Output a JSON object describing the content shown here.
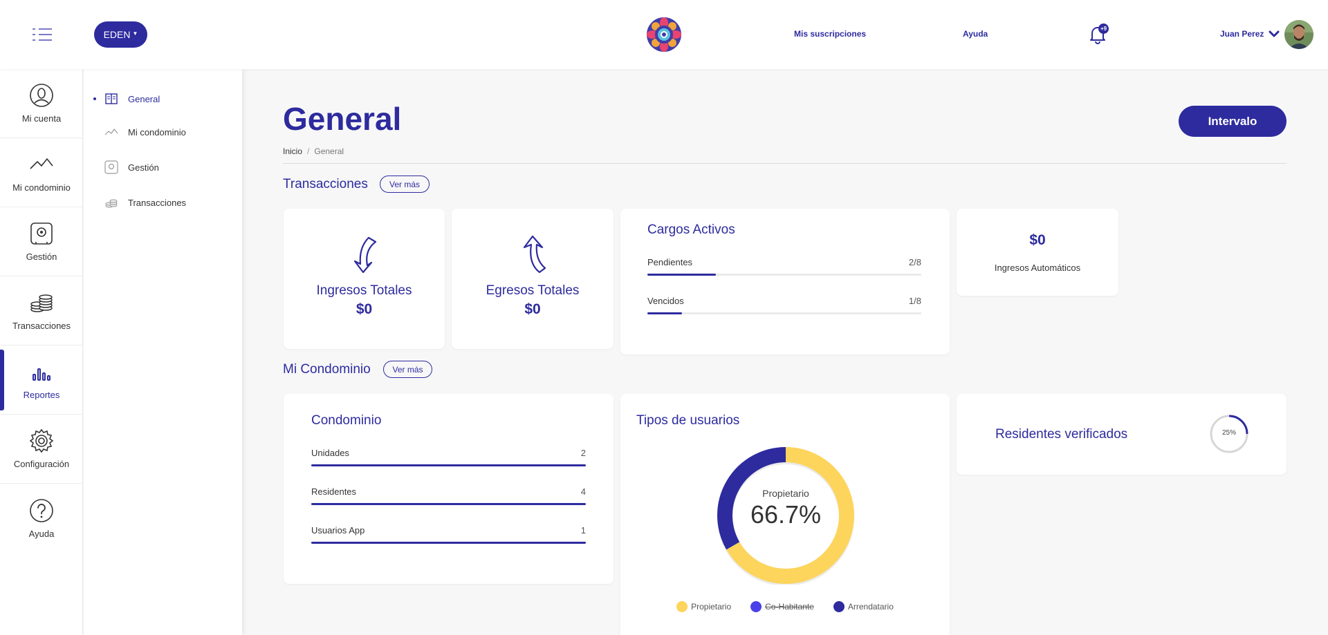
{
  "header": {
    "project_label": "EDEN",
    "links": {
      "subscriptions": "Mis suscripciones",
      "help": "Ayuda"
    },
    "notifications_badge": "+9",
    "user_name": "Juan Perez",
    "accent_color": "#2d2b9e"
  },
  "rail": {
    "items": [
      {
        "label": "Mi cuenta",
        "icon": "user-circle-icon"
      },
      {
        "label": "Mi condominio",
        "icon": "roof-icon"
      },
      {
        "label": "Gestión",
        "icon": "safe-icon"
      },
      {
        "label": "Transacciones",
        "icon": "coins-icon"
      },
      {
        "label": "Reportes",
        "icon": "bar-chart-icon",
        "active": true
      },
      {
        "label": "Configuración",
        "icon": "gear-icon"
      },
      {
        "label": "Ayuda",
        "icon": "question-icon"
      }
    ]
  },
  "subnav": {
    "items": [
      {
        "label": "General",
        "icon": "book-icon",
        "active": true
      },
      {
        "label": "Mi condominio",
        "icon": "roof-icon"
      },
      {
        "label": "Gestión",
        "icon": "safe-icon"
      },
      {
        "label": "Transacciones",
        "icon": "coins-icon"
      }
    ]
  },
  "main": {
    "title": "General",
    "interval_button": "Intervalo",
    "breadcrumb": {
      "home": "Inicio",
      "sep": "/",
      "current": "General"
    },
    "transactions": {
      "section_title": "Transacciones",
      "ver_mas": "Ver más",
      "income": {
        "label": "Ingresos Totales",
        "value": "$0"
      },
      "expenses": {
        "label": "Egresos Totales",
        "value": "$0"
      },
      "active_charges": {
        "title": "Cargos Activos",
        "rows": [
          {
            "label": "Pendientes",
            "value": "2/8",
            "fraction": 0.25
          },
          {
            "label": "Vencidos",
            "value": "1/8",
            "fraction": 0.125
          }
        ]
      },
      "automatic_income": {
        "value": "$0",
        "label": "Ingresos Automáticos"
      }
    },
    "condominium": {
      "section_title": "Mi Condominio",
      "ver_mas": "Ver más",
      "summary": {
        "title": "Condominio",
        "rows": [
          {
            "label": "Unidades",
            "value": "2",
            "fraction": 1
          },
          {
            "label": "Residentes",
            "value": "4",
            "fraction": 1
          },
          {
            "label": "Usuarios App",
            "value": "1",
            "fraction": 1
          }
        ]
      },
      "user_types": {
        "title": "Tipos de usuarios",
        "center_label": "Propietario",
        "center_value": "66.7%"
      },
      "verified": {
        "title": "Residentes verificados",
        "percent_label": "25%",
        "fraction": 0.25
      }
    }
  },
  "chart_data": {
    "type": "pie",
    "title": "Tipos de usuarios",
    "series": [
      {
        "name": "Propietario",
        "value": 66.7,
        "color": "#fdd45c",
        "visible": true
      },
      {
        "name": "Co-Habitante",
        "value": 0,
        "color": "#4a40e8",
        "visible": false
      },
      {
        "name": "Arrendatario",
        "value": 33.3,
        "color": "#2d2b9e",
        "visible": true
      }
    ],
    "legend_position": "bottom"
  }
}
